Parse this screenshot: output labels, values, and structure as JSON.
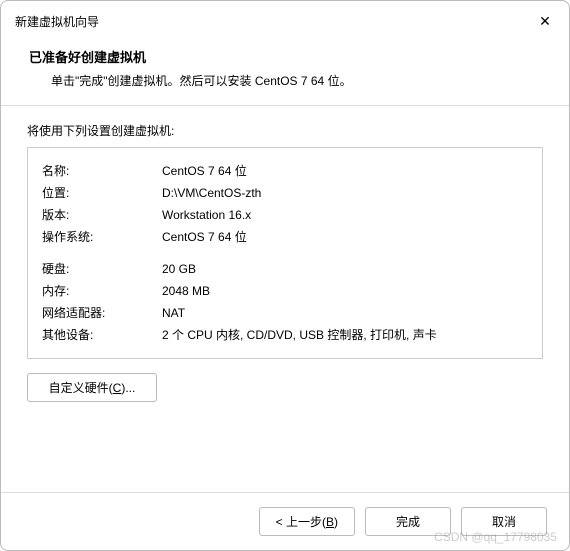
{
  "window": {
    "title": "新建虚拟机向导"
  },
  "header": {
    "heading": "已准备好创建虚拟机",
    "subheading": "单击\"完成\"创建虚拟机。然后可以安装 CentOS 7 64 位。"
  },
  "content": {
    "intro": "将使用下列设置创建虚拟机:",
    "group1": [
      {
        "label": "名称:",
        "value": "CentOS 7 64 位"
      },
      {
        "label": "位置:",
        "value": "D:\\VM\\CentOS-zth"
      },
      {
        "label": "版本:",
        "value": "Workstation 16.x"
      },
      {
        "label": "操作系统:",
        "value": "CentOS 7 64 位"
      }
    ],
    "group2": [
      {
        "label": "硬盘:",
        "value": "20 GB"
      },
      {
        "label": "内存:",
        "value": "2048 MB"
      },
      {
        "label": "网络适配器:",
        "value": "NAT"
      },
      {
        "label": "其他设备:",
        "value": "2 个 CPU 内核, CD/DVD, USB 控制器, 打印机, 声卡"
      }
    ]
  },
  "buttons": {
    "customize_prefix": "自定义硬件(",
    "customize_key": "C",
    "customize_suffix": ")...",
    "back_prefix": "< 上一步(",
    "back_key": "B",
    "back_suffix": ")",
    "finish": "完成",
    "cancel": "取消"
  },
  "watermark": "CSDN @qq_17798035"
}
